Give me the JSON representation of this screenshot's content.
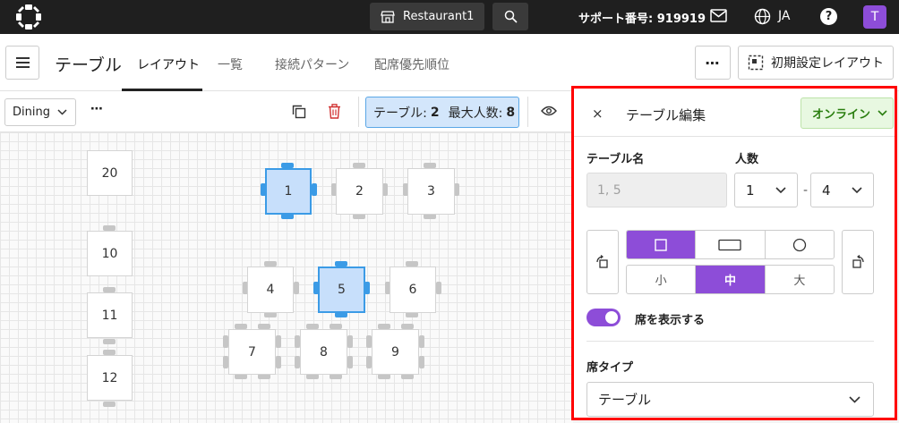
{
  "topbar": {
    "restaurant": "Restaurant1",
    "support": "サポート番号: 919919",
    "language": "JA",
    "help": "?",
    "avatar": "T"
  },
  "header": {
    "title": "テーブル",
    "tabs": [
      {
        "label": "レイアウト",
        "active": true
      },
      {
        "label": "一覧",
        "active": false
      },
      {
        "label": "接続パターン",
        "active": false
      },
      {
        "label": "配席優先順位",
        "active": false
      }
    ],
    "more": "⋯",
    "initial_layout": "初期設定レイアウト"
  },
  "toolbar": {
    "area": "Dining",
    "more": "⋯",
    "table_label": "テーブル:",
    "table_count": "2",
    "max_label": "最大人数:",
    "max_count": "8"
  },
  "canvas": {
    "tables": [
      "20",
      "10",
      "11",
      "12",
      "1",
      "2",
      "3",
      "4",
      "5",
      "6",
      "7",
      "8",
      "9"
    ],
    "selected": [
      "1",
      "5"
    ]
  },
  "panel": {
    "close": "×",
    "title": "テーブル編集",
    "status": "オンライン",
    "name_label": "テーブル名",
    "name_value": "1, 5",
    "count_label": "人数",
    "min": "1",
    "dash": "-",
    "max": "4",
    "sizes": [
      "小",
      "中",
      "大"
    ],
    "selected_size": "中",
    "show_seats": "席を表示する",
    "seat_type_label": "席タイプ",
    "seat_type": "テーブル"
  },
  "colors": {
    "accent": "#8d4dd8",
    "selected_table": "#3b9be6",
    "online": "#2a7e0f",
    "highlight_border": "#ff0000"
  }
}
